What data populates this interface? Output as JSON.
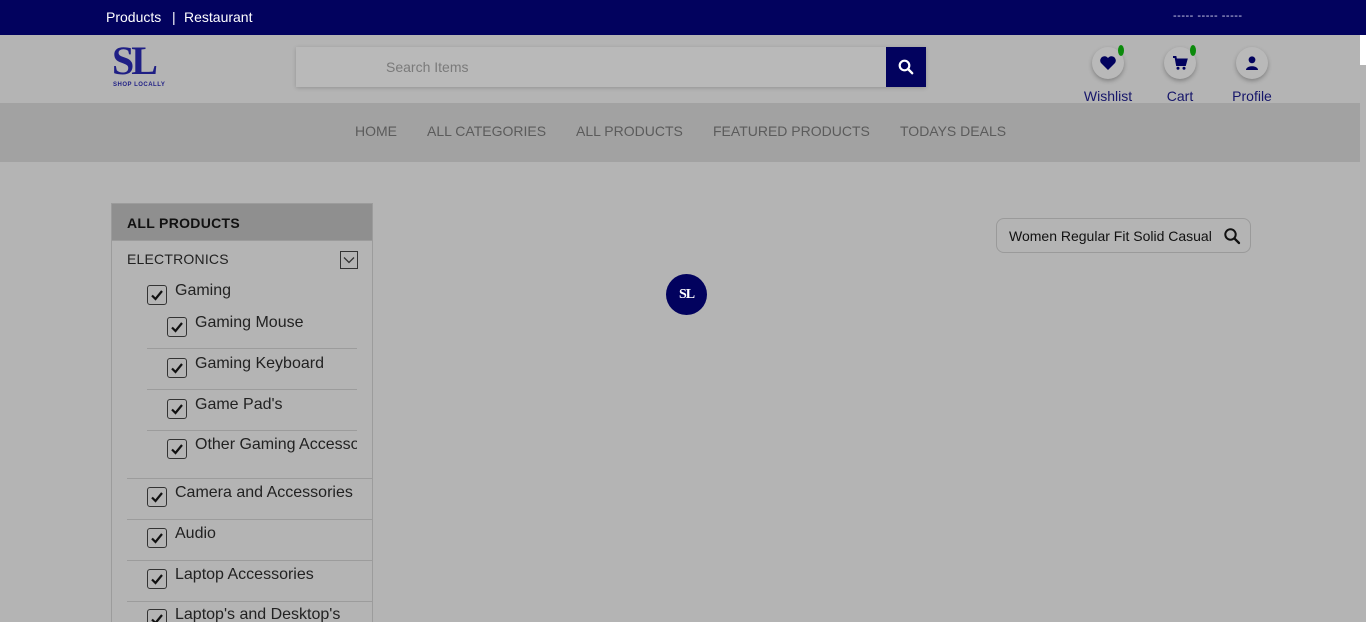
{
  "topbar": {
    "products_link": "Products",
    "separator": "|",
    "restaurant_link": "Restaurant",
    "account_placeholder": "----- ----- -----"
  },
  "logo": {
    "letters": "SL",
    "tagline": "SHOP LOCALLY"
  },
  "search": {
    "placeholder": "Search Items",
    "button_icon": "search-icon"
  },
  "header_icons": [
    {
      "label": "Wishlist",
      "icon": "heart-icon"
    },
    {
      "label": "Cart",
      "icon": "cart-icon"
    },
    {
      "label": "Profile",
      "icon": "user-icon"
    }
  ],
  "nav": {
    "items": [
      "HOME",
      "ALL CATEGORIES",
      "ALL PRODUCTS",
      "FEATURED PRODUCTS",
      "TODAYS DEALS"
    ]
  },
  "sidebar": {
    "title": "ALL PRODUCTS",
    "category": "ELECTRONICS",
    "items": [
      {
        "label": "Gaming",
        "checked": true
      },
      {
        "label": "Gaming Mouse",
        "checked": true
      },
      {
        "label": "Gaming Keyboard",
        "checked": true
      },
      {
        "label": "Game Pad's",
        "checked": true
      },
      {
        "label": "Other Gaming Accessories",
        "checked": true
      },
      {
        "label": "Camera and Accessories",
        "checked": true
      },
      {
        "label": "Audio",
        "checked": true
      },
      {
        "label": "Laptop Accessories",
        "checked": true
      },
      {
        "label": "Laptop's and Desktop's",
        "checked": true
      }
    ]
  },
  "filter": {
    "value": "Women Regular Fit Solid Casual"
  },
  "loader": {
    "text": "SL"
  },
  "colors": {
    "primary": "#02025e",
    "badge": "#0b8a0b",
    "overlay_bg": "#b4b4b4",
    "nav_bg": "#a2a2a2"
  }
}
